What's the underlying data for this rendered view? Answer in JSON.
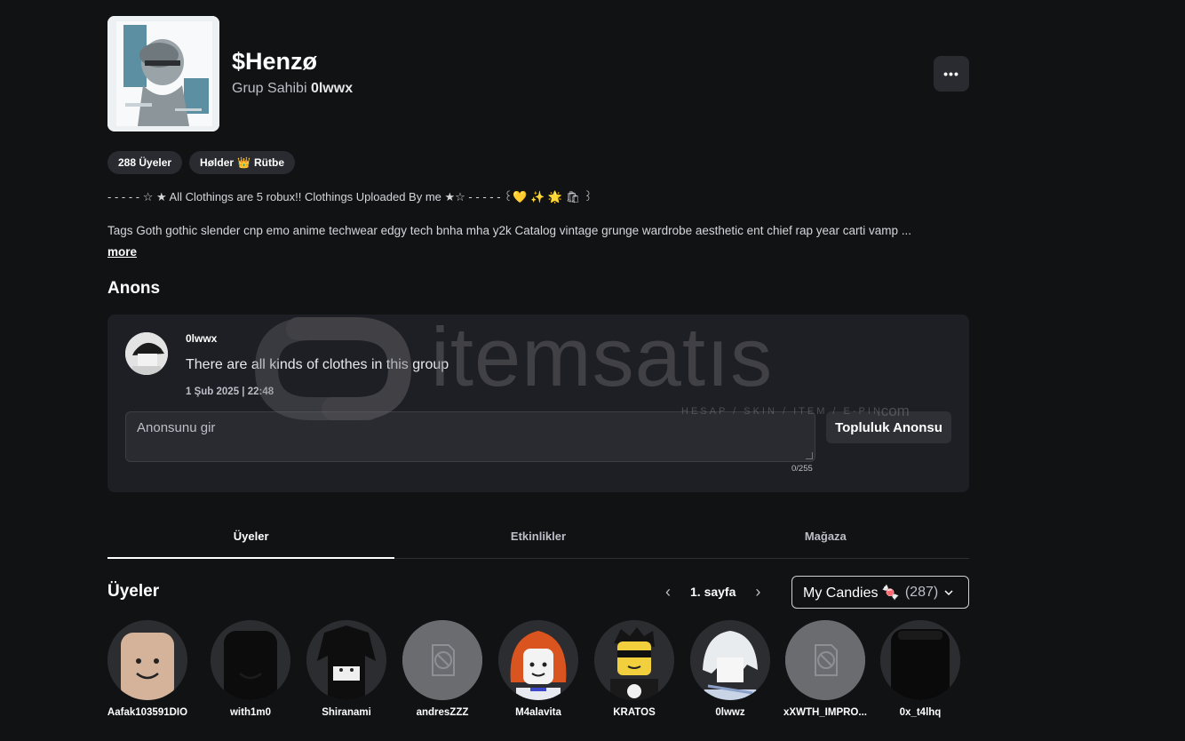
{
  "group": {
    "name": "$Henzø",
    "owner_prefix": "Grup Sahibi",
    "owner_name": "0lwwx",
    "more_label": "•••"
  },
  "chips": {
    "members": "288 Üyeler",
    "rank_prefix": "Hølder",
    "rank_emoji": "👑",
    "rank_suffix": "Rütbe"
  },
  "description": {
    "line1": "- - - - - ☆ ★ All Clothings are 5 robux!! Clothings Uploaded By me ★☆ - - - - -  ꒰💛 ✨ 🌟 🛍 ꒱",
    "line2": "Tags Goth gothic slender cnp emo anime techwear edgy tech bnha mha y2k Catalog vintage grunge wardrobe aesthetic ent chief rap year carti vamp ...",
    "more": "more"
  },
  "announcement": {
    "title": "Anons",
    "author": "0lwwx",
    "text": "There are all kinds of clothes in this group",
    "date": "1 Şub 2025 | 22:48",
    "input_placeholder": "Anonsunu gir",
    "char_count": "0/255",
    "submit_label": "Topluluk Anonsu"
  },
  "watermark": {
    "brand": "itemsatıs",
    "tagline": "HESAP / SKIN / ITEM / E-PIN",
    "domain": ".com"
  },
  "tabs": [
    {
      "label": "Üyeler",
      "active": true
    },
    {
      "label": "Etkinlikler",
      "active": false
    },
    {
      "label": "Mağaza",
      "active": false
    }
  ],
  "members_section": {
    "title": "Üyeler",
    "page_label": "1. sayfa",
    "role_name": "My Candies 🍬",
    "role_count": "(287)"
  },
  "members": [
    {
      "name": "Aafak103591DIO",
      "avatar": "noob-smile"
    },
    {
      "name": "with1m0",
      "avatar": "black-smile"
    },
    {
      "name": "Shiranami",
      "avatar": "black-hair"
    },
    {
      "name": "andresZZZ",
      "avatar": "blocked"
    },
    {
      "name": "M4alavita",
      "avatar": "red-hair"
    },
    {
      "name": "KRATOS",
      "avatar": "sunglasses"
    },
    {
      "name": "0lwwz",
      "avatar": "white-hair"
    },
    {
      "name": "xXWTH_IMPRO...",
      "avatar": "blocked"
    },
    {
      "name": "0x_t4lhq",
      "avatar": "black-head"
    }
  ],
  "colors": {
    "background": "#111214",
    "panel": "#1e1f24",
    "chip": "#2a2b30",
    "text_muted": "#bcbec8"
  }
}
